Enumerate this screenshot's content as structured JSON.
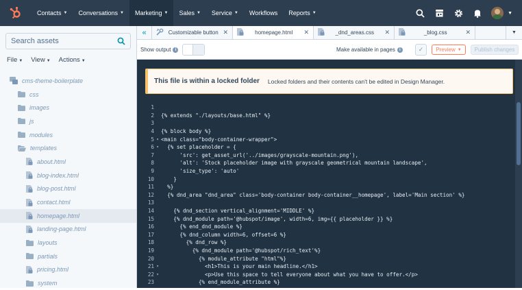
{
  "nav": {
    "items": [
      {
        "label": "Contacts",
        "dropdown": true
      },
      {
        "label": "Conversations",
        "dropdown": true
      },
      {
        "label": "Marketing",
        "dropdown": true,
        "active": true
      },
      {
        "label": "Sales",
        "dropdown": true
      },
      {
        "label": "Service",
        "dropdown": true
      },
      {
        "label": "Workflows",
        "dropdown": false
      },
      {
        "label": "Reports",
        "dropdown": true
      }
    ],
    "icons": [
      "search-icon",
      "marketplace-icon",
      "settings-icon",
      "notifications-icon"
    ]
  },
  "sidebar": {
    "search_placeholder": "Search assets",
    "menus": [
      "File",
      "View",
      "Actions"
    ],
    "tree": [
      {
        "label": "cms-theme-boilerplate",
        "type": "theme",
        "depth": 0
      },
      {
        "label": "css",
        "type": "folder",
        "depth": 1
      },
      {
        "label": "images",
        "type": "folder",
        "depth": 1
      },
      {
        "label": "js",
        "type": "folder",
        "depth": 1
      },
      {
        "label": "modules",
        "type": "folder",
        "depth": 1
      },
      {
        "label": "templates",
        "type": "folder-open",
        "depth": 1
      },
      {
        "label": "about.html",
        "type": "file-locked",
        "depth": 2
      },
      {
        "label": "blog-index.html",
        "type": "file-locked",
        "depth": 2
      },
      {
        "label": "blog-post.html",
        "type": "file-locked",
        "depth": 2
      },
      {
        "label": "contact.html",
        "type": "file-locked",
        "depth": 2
      },
      {
        "label": "homepage.html",
        "type": "file-locked",
        "depth": 2,
        "selected": true
      },
      {
        "label": "landing-page.html",
        "type": "file-locked",
        "depth": 2
      },
      {
        "label": "layouts",
        "type": "folder",
        "depth": 2
      },
      {
        "label": "partials",
        "type": "folder",
        "depth": 2
      },
      {
        "label": "pricing.html",
        "type": "file-locked",
        "depth": 2
      },
      {
        "label": "system",
        "type": "folder",
        "depth": 2
      }
    ]
  },
  "tabs": [
    {
      "label": "Customizable button",
      "icon": "module-icon",
      "active": false
    },
    {
      "label": "homepage.html",
      "icon": "file-lock-icon",
      "active": true
    },
    {
      "label": "_dnd_areas.css",
      "icon": "file-lock-icon",
      "active": false
    },
    {
      "label": "_blog.css",
      "icon": "file-lock-icon",
      "active": false
    }
  ],
  "toolbar": {
    "show_output_label": "Show output",
    "make_available_label": "Make available in pages",
    "preview_label": "Preview",
    "publish_label": "Publish changes"
  },
  "banner": {
    "title": "This file is within a locked folder",
    "text": "Locked folders and their contents can't be edited in Design Manager."
  },
  "code": [
    {
      "n": "1",
      "fold": false,
      "text": ""
    },
    {
      "n": "2",
      "fold": false,
      "text": "{% extends \"./layouts/base.html\" %}"
    },
    {
      "n": "3",
      "fold": false,
      "text": ""
    },
    {
      "n": "4",
      "fold": false,
      "text": "{% block body %}"
    },
    {
      "n": "5",
      "fold": true,
      "text": "<main class=\"body-container-wrapper\">"
    },
    {
      "n": "6",
      "fold": true,
      "text": "  {% set placeholder = {"
    },
    {
      "n": "7",
      "fold": false,
      "text": "      'src': get_asset_url('../images/grayscale-mountain.png'),"
    },
    {
      "n": "8",
      "fold": false,
      "text": "      'alt': 'Stock placeholder image with grayscale geometrical mountain landscape',"
    },
    {
      "n": "9",
      "fold": false,
      "text": "      'size_type': 'auto'"
    },
    {
      "n": "10",
      "fold": false,
      "text": "    }"
    },
    {
      "n": "11",
      "fold": false,
      "text": "  %}"
    },
    {
      "n": "12",
      "fold": false,
      "text": "  {% dnd_area \"dnd_area\" class='body-container body-container__homepage', label='Main section' %}"
    },
    {
      "n": "13",
      "fold": false,
      "text": ""
    },
    {
      "n": "14",
      "fold": false,
      "text": "    {% dnd_section vertical_alignment='MIDDLE' %}"
    },
    {
      "n": "15",
      "fold": false,
      "text": "    {% dnd_module path='@hubspot/image', width=6, img={{ placeholder }} %}"
    },
    {
      "n": "16",
      "fold": false,
      "text": "      {% end_dnd_module %}"
    },
    {
      "n": "17",
      "fold": false,
      "text": "      {% dnd_column width=6, offset=6 %}"
    },
    {
      "n": "18",
      "fold": false,
      "text": "        {% dnd_row %}"
    },
    {
      "n": "19",
      "fold": false,
      "text": "          {% dnd_module path='@hubspot/rich_text'%}"
    },
    {
      "n": "20",
      "fold": false,
      "text": "            {% module_attribute \"html\"%}"
    },
    {
      "n": "21",
      "fold": true,
      "text": "              <h1>This is your main headline.</h1>"
    },
    {
      "n": "22",
      "fold": true,
      "text": "              <p>Use this space to tell everyone about what you have to offer.</p>"
    },
    {
      "n": "23",
      "fold": false,
      "text": "            {% end_module_attribute %}"
    }
  ]
}
